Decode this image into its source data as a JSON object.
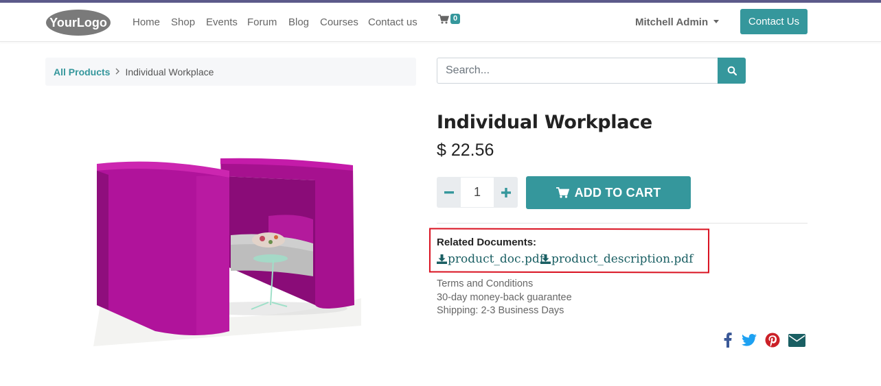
{
  "header": {
    "logo_text": "YourLogo",
    "nav": [
      "Home",
      "Shop",
      "Events",
      "Forum",
      "Blog",
      "Courses",
      "Contact us"
    ],
    "cart_icon": "shopping-cart-icon",
    "cart_count": "0",
    "user_name": "Mitchell Admin",
    "contact_button": "Contact Us"
  },
  "breadcrumb": {
    "root": "All Products",
    "separator_icon": "chevron-right-icon",
    "current": "Individual Workplace"
  },
  "search": {
    "placeholder": "Search...",
    "icon": "search-icon"
  },
  "product": {
    "title": "Individual Workplace",
    "price": "$ 22.56",
    "quantity": "1",
    "add_to_cart": "ADD TO CART",
    "image_alt": "magenta individual workplace booth"
  },
  "related": {
    "title": "Related Documents:",
    "documents": [
      "product_doc.pdf",
      "product_description.pdf"
    ],
    "icon": "download-icon"
  },
  "terms": {
    "line1": "Terms and Conditions",
    "line2": "30-day money-back guarantee",
    "line3": "Shipping: 2-3 Business Days"
  },
  "social": [
    "facebook-icon",
    "twitter-icon",
    "pinterest-icon",
    "envelope-icon"
  ],
  "colors": {
    "accent": "#35979c",
    "link": "#1a5f63",
    "highlight_border": "#d9101f",
    "facebook": "#3b5998",
    "twitter": "#1da1f2",
    "pinterest": "#cb2027",
    "email": "#1a5f63"
  }
}
